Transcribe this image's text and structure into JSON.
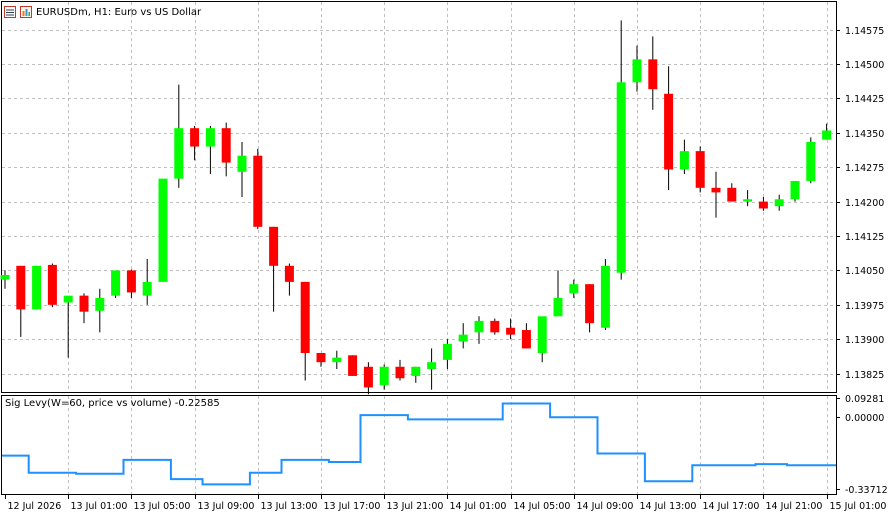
{
  "header": {
    "symbol": "EURUSDm",
    "timeframe": "H1",
    "description": "Euro vs US Dollar",
    "title_text": "EURUSDm, H1:  Euro vs US Dollar"
  },
  "indicator": {
    "label": "Sig Levy(W=60, price vs volume) -0.22585"
  },
  "colors": {
    "bull": "#00ff00",
    "bear": "#ff0000",
    "wick": "#000000",
    "indicator_line": "#1e90ff",
    "grid": "#c0c0c0"
  },
  "chart_data": [
    {
      "type": "candlestick",
      "title": "EURUSDm, H1:  Euro vs US Dollar",
      "price_axis_ticks": [
        "1.14575",
        "1.14500",
        "1.14425",
        "1.14350",
        "1.14275",
        "1.14200",
        "1.14125",
        "1.14050",
        "1.13975",
        "1.13900",
        "1.13825"
      ],
      "time_axis_labels": [
        "12 Jul 2026",
        "13 Jul 01:00",
        "13 Jul 05:00",
        "13 Jul 09:00",
        "13 Jul 13:00",
        "13 Jul 17:00",
        "13 Jul 21:00",
        "14 Jul 01:00",
        "14 Jul 05:00",
        "14 Jul 09:00",
        "14 Jul 13:00",
        "14 Jul 17:00",
        "14 Jul 21:00",
        "15 Jul 01:00"
      ],
      "ylim": [
        1.13785,
        1.14635
      ],
      "grid": true,
      "candles": [
        {
          "open": 1.1403,
          "high": 1.1405,
          "low": 1.1401,
          "close": 1.1404
        },
        {
          "open": 1.1406,
          "high": 1.1406,
          "low": 1.13905,
          "close": 1.13965
        },
        {
          "open": 1.13965,
          "high": 1.1406,
          "low": 1.13965,
          "close": 1.1406
        },
        {
          "open": 1.14062,
          "high": 1.14065,
          "low": 1.1397,
          "close": 1.13975
        },
        {
          "open": 1.1398,
          "high": 1.13985,
          "low": 1.1386,
          "close": 1.13995
        },
        {
          "open": 1.13995,
          "high": 1.14,
          "low": 1.13935,
          "close": 1.1396
        },
        {
          "open": 1.13962,
          "high": 1.1401,
          "low": 1.13915,
          "close": 1.1399
        },
        {
          "open": 1.13995,
          "high": 1.1405,
          "low": 1.1399,
          "close": 1.1405
        },
        {
          "open": 1.1405,
          "high": 1.14052,
          "low": 1.1399,
          "close": 1.14002
        },
        {
          "open": 1.13995,
          "high": 1.14075,
          "low": 1.13975,
          "close": 1.14025
        },
        {
          "open": 1.14025,
          "high": 1.141,
          "low": 1.14025,
          "close": 1.1425
        },
        {
          "open": 1.1425,
          "high": 1.14455,
          "low": 1.1423,
          "close": 1.1436
        },
        {
          "open": 1.1436,
          "high": 1.14365,
          "low": 1.1429,
          "close": 1.1432
        },
        {
          "open": 1.1432,
          "high": 1.14365,
          "low": 1.1426,
          "close": 1.1436
        },
        {
          "open": 1.1436,
          "high": 1.14372,
          "low": 1.14255,
          "close": 1.14285
        },
        {
          "open": 1.14265,
          "high": 1.1433,
          "low": 1.1421,
          "close": 1.143
        },
        {
          "open": 1.143,
          "high": 1.14315,
          "low": 1.1414,
          "close": 1.14145
        },
        {
          "open": 1.14145,
          "high": 1.14145,
          "low": 1.1396,
          "close": 1.1406
        },
        {
          "open": 1.1406,
          "high": 1.14065,
          "low": 1.13995,
          "close": 1.14025
        },
        {
          "open": 1.14025,
          "high": 1.14025,
          "low": 1.1381,
          "close": 1.1387
        },
        {
          "open": 1.1387,
          "high": 1.1387,
          "low": 1.1384,
          "close": 1.1385
        },
        {
          "open": 1.1385,
          "high": 1.13875,
          "low": 1.13835,
          "close": 1.1386
        },
        {
          "open": 1.13865,
          "high": 1.13865,
          "low": 1.1382,
          "close": 1.1382
        },
        {
          "open": 1.1384,
          "high": 1.1385,
          "low": 1.1378,
          "close": 1.13795
        },
        {
          "open": 1.138,
          "high": 1.13845,
          "low": 1.1379,
          "close": 1.1384
        },
        {
          "open": 1.1384,
          "high": 1.13855,
          "low": 1.1381,
          "close": 1.13815
        },
        {
          "open": 1.1382,
          "high": 1.1384,
          "low": 1.13805,
          "close": 1.1384
        },
        {
          "open": 1.13835,
          "high": 1.1388,
          "low": 1.1379,
          "close": 1.1385
        },
        {
          "open": 1.13855,
          "high": 1.139,
          "low": 1.13835,
          "close": 1.1389
        },
        {
          "open": 1.13895,
          "high": 1.13935,
          "low": 1.1388,
          "close": 1.1391
        },
        {
          "open": 1.13915,
          "high": 1.1395,
          "low": 1.1389,
          "close": 1.1394
        },
        {
          "open": 1.1394,
          "high": 1.13945,
          "low": 1.1391,
          "close": 1.13915
        },
        {
          "open": 1.13925,
          "high": 1.13945,
          "low": 1.139,
          "close": 1.1391
        },
        {
          "open": 1.1392,
          "high": 1.13935,
          "low": 1.1388,
          "close": 1.1388
        },
        {
          "open": 1.1387,
          "high": 1.1387,
          "low": 1.1385,
          "close": 1.1395
        },
        {
          "open": 1.1395,
          "high": 1.1405,
          "low": 1.1396,
          "close": 1.1399
        },
        {
          "open": 1.14,
          "high": 1.1403,
          "low": 1.1399,
          "close": 1.1402
        },
        {
          "open": 1.1402,
          "high": 1.1402,
          "low": 1.13915,
          "close": 1.13935
        },
        {
          "open": 1.13925,
          "high": 1.14075,
          "low": 1.1392,
          "close": 1.1406
        },
        {
          "open": 1.14045,
          "high": 1.14595,
          "low": 1.1403,
          "close": 1.1446
        },
        {
          "open": 1.1446,
          "high": 1.1454,
          "low": 1.1444,
          "close": 1.1451
        },
        {
          "open": 1.1451,
          "high": 1.1456,
          "low": 1.144,
          "close": 1.14445
        },
        {
          "open": 1.14435,
          "high": 1.14495,
          "low": 1.14225,
          "close": 1.1427
        },
        {
          "open": 1.1427,
          "high": 1.14335,
          "low": 1.1426,
          "close": 1.1431
        },
        {
          "open": 1.1431,
          "high": 1.1432,
          "low": 1.1422,
          "close": 1.1423
        },
        {
          "open": 1.1423,
          "high": 1.14265,
          "low": 1.14165,
          "close": 1.1422
        },
        {
          "open": 1.1423,
          "high": 1.1424,
          "low": 1.142,
          "close": 1.142
        },
        {
          "open": 1.142,
          "high": 1.14225,
          "low": 1.1419,
          "close": 1.14205
        },
        {
          "open": 1.142,
          "high": 1.1421,
          "low": 1.1418,
          "close": 1.14185
        },
        {
          "open": 1.1419,
          "high": 1.14215,
          "low": 1.1418,
          "close": 1.14205
        },
        {
          "open": 1.14205,
          "high": 1.14245,
          "low": 1.142,
          "close": 1.14245
        },
        {
          "open": 1.14245,
          "high": 1.1434,
          "low": 1.1424,
          "close": 1.1433
        },
        {
          "open": 1.14335,
          "high": 1.1437,
          "low": 1.14335,
          "close": 1.14355
        }
      ]
    },
    {
      "type": "line",
      "title": "Sig Levy(W=60, price vs volume) -0.22585",
      "price_axis_ticks": [
        "0.09281",
        "0.00000",
        "-0.33712"
      ],
      "ylim": [
        -0.36,
        0.1
      ],
      "series": [
        {
          "values": [
            -0.18,
            -0.18,
            -0.26,
            -0.26,
            -0.26,
            -0.265,
            -0.265,
            -0.265,
            -0.2,
            -0.2,
            -0.2,
            -0.29,
            -0.29,
            -0.315,
            -0.315,
            -0.315,
            -0.26,
            -0.26,
            -0.2,
            -0.2,
            -0.2,
            -0.21,
            -0.21,
            0.01,
            0.01,
            0.01,
            -0.01,
            -0.01,
            -0.01,
            -0.01,
            -0.01,
            -0.01,
            0.065,
            0.065,
            0.065,
            0.0,
            0.0,
            0.0,
            -0.17,
            -0.17,
            -0.17,
            -0.3,
            -0.3,
            -0.3,
            -0.225,
            -0.225,
            -0.225,
            -0.225,
            -0.22,
            -0.22,
            -0.225,
            -0.225,
            -0.225,
            -0.225
          ]
        }
      ]
    }
  ]
}
